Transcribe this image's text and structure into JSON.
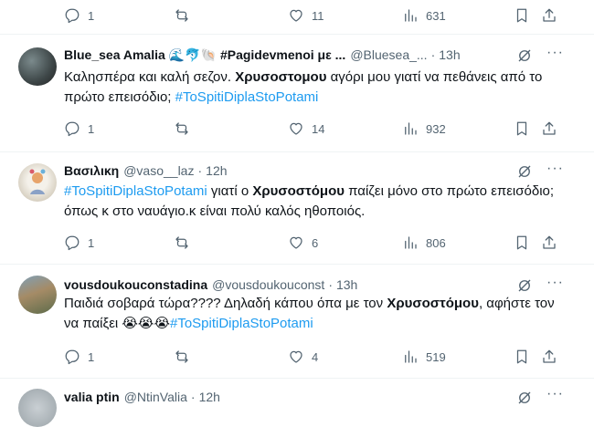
{
  "top_actions": {
    "replies": "1",
    "likes": "11",
    "views": "631"
  },
  "tweets": [
    {
      "name": "Blue_sea Amalia",
      "name_extra": "🌊🐬🐚 #Pagidevmenoi με ...",
      "handle": "@Bluesea_...",
      "dot": "·",
      "time": "13h",
      "text": {
        "p1": "Καλησπέρα και καλή σεζον. ",
        "b1": "Χρυσοστομου",
        "p2": " αγόρι μου γιατί να πεθάνεις από το πρώτο επεισόδιο; ",
        "tag1": "#ToSpitiDiplaStoPotami"
      },
      "replies": "1",
      "likes": "14",
      "views": "932"
    },
    {
      "name": "Βασιλικη",
      "handle": "@vaso__laz",
      "dot": "·",
      "time": "12h",
      "text": {
        "tag1": "#ToSpitiDiplaStoPotami",
        "p1": " γιατί ο ",
        "b1": "Χρυσοστόμου",
        "p2": " παίζει μόνο στο πρώτο επεισόδιο; όπως κ στο ναυάγιο.κ είναι πολύ καλός ηθοποιός."
      },
      "replies": "1",
      "likes": "6",
      "views": "806"
    },
    {
      "name": "vousdoukouconstadina",
      "handle": "@vousdoukouconst",
      "dot": "·",
      "time": "13h",
      "text": {
        "p1": "Παιδιά σοβαρά τώρα???? Δηλαδή κάπου όπα με τον ",
        "b1": "Χρυσοστόμου",
        "p2": ", αφήστε τον να παίξει ",
        "emoji": "😭😭😭",
        "tag1": "#ToSpitiDiplaStoPotami"
      },
      "replies": "1",
      "likes": "4",
      "views": "519"
    },
    {
      "name": "valia ptin",
      "handle": "@NtinValia",
      "dot": "·",
      "time": "12h"
    }
  ],
  "icons": {
    "reply": "reply-icon",
    "retweet": "retweet-icon",
    "like": "heart-icon",
    "views": "views-icon",
    "bookmark": "bookmark-icon",
    "share": "share-icon",
    "grok": "grok-icon",
    "more": "more-icon"
  },
  "colors": {
    "link": "#1d9bf0",
    "muted": "#536471",
    "text": "#0f1419"
  }
}
